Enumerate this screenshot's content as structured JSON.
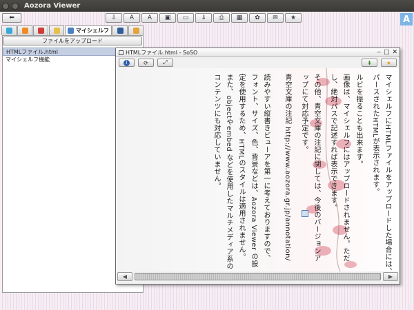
{
  "app": {
    "title": "Aozora Viewer",
    "logo_letter": "A"
  },
  "toolbar": {
    "back_icon": "arrow-left-icon",
    "buttons": [
      {
        "name": "import-icon",
        "glyph": "⇩"
      },
      {
        "name": "font-icon",
        "glyph": "A"
      },
      {
        "name": "font-bold-icon",
        "glyph": "A"
      },
      {
        "name": "save-icon",
        "glyph": "▣"
      },
      {
        "name": "folder-icon",
        "glyph": "▭"
      },
      {
        "name": "download-icon",
        "glyph": "⇓"
      },
      {
        "name": "print-icon",
        "glyph": "⎙"
      },
      {
        "name": "image-icon",
        "glyph": "▦"
      },
      {
        "name": "settings-icon",
        "glyph": "✿"
      },
      {
        "name": "comment-icon",
        "glyph": "✉"
      },
      {
        "name": "favorite-icon",
        "glyph": "★"
      }
    ]
  },
  "tabs": {
    "items": [
      {
        "name": "tab-library",
        "color": "#3aa7d8"
      },
      {
        "name": "tab-rss",
        "color": "#f08a24"
      },
      {
        "name": "tab-favorites",
        "color": "#d23a3a"
      },
      {
        "name": "tab-notes",
        "color": "#e5c04a"
      },
      {
        "name": "tab-myshelf",
        "label": "マイシェルフ",
        "color": "#4a7fc0"
      },
      {
        "name": "tab-history",
        "color": "#2f5d9a"
      },
      {
        "name": "tab-folder",
        "color": "#e2a33b"
      }
    ]
  },
  "sidebar": {
    "upload_button": "ファイルをアップロード",
    "items": [
      {
        "label": "HTMLファイル.html",
        "selected": true
      },
      {
        "label": "マイシェルフ機能",
        "selected": false
      }
    ]
  },
  "viewer": {
    "title": "HTMLファイル.html - SoSO",
    "controls": [
      "‒",
      "□",
      "✕"
    ],
    "content_columns": [
      "マイシェルフにHTMLファイルをアップロードした場合には、",
      "パースされたHTMLが表示されます。",
      "ルビを振ることも出来ます。",
      "画像は、マイシェルフにはアップロードされません。ただ",
      "し、絶対パスで記述すれば表示できます。",
      "その他、青空文庫の注記に関しては、今後のバージョンア",
      "ップにて対応予定です。",
      "青空文庫の注記 http://www.aozora.gr.jp/annotation/",
      "読みやすい縦書きビューアを第一に考えておりますので、",
      "フォント、サイズ、色、背景などは、Aozora Viewer の設",
      "定を使用するため、HTMLのスタイルは適用されません。",
      "また、objectやembed などを使用したマルチメディア系の",
      "コンテンツにも対応していません。"
    ]
  },
  "colors": {
    "accent": "#7fb4e6",
    "selected_row": "#c4cfe4"
  }
}
